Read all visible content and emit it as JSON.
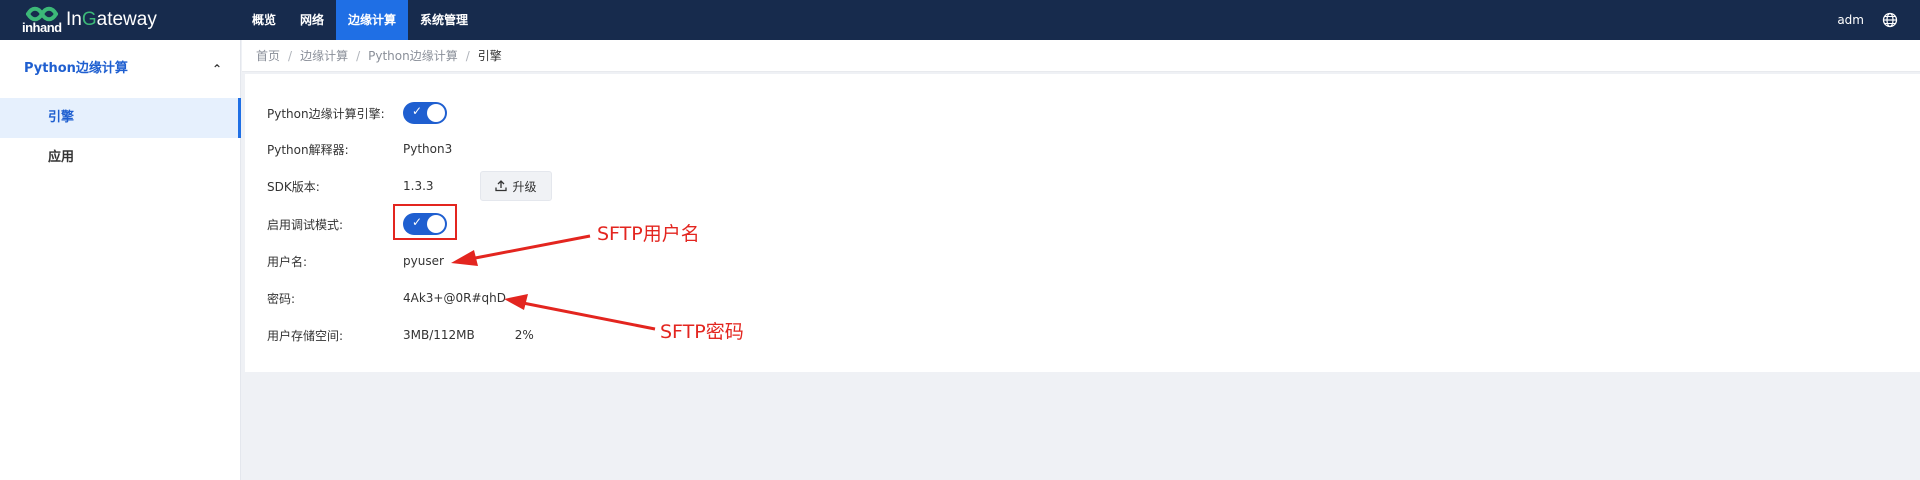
{
  "app": {
    "logo_mark": "inhand",
    "name_prefix": "In",
    "name_g": "G",
    "name_suffix": "ateway"
  },
  "nav": [
    {
      "label": "概览"
    },
    {
      "label": "网络"
    },
    {
      "label": "边缘计算",
      "active": true
    },
    {
      "label": "系统管理"
    }
  ],
  "user": {
    "name": "adm",
    "icon": "globe-icon"
  },
  "sidebar": {
    "group": "Python边缘计算",
    "items": [
      {
        "label": "引擎",
        "active": true
      },
      {
        "label": "应用"
      }
    ]
  },
  "breadcrumb": [
    "首页",
    "边缘计算",
    "Python边缘计算",
    "引擎"
  ],
  "engine": {
    "engine_label": "Python边缘计算引擎:",
    "engine_enabled": true,
    "interpreter_label": "Python解释器:",
    "interpreter_value": "Python3",
    "sdk_label": "SDK版本:",
    "sdk_value": "1.3.3",
    "upgrade_label": "升级",
    "debug_label": "启用调试模式:",
    "debug_enabled": true,
    "username_label": "用户名:",
    "username_value": "pyuser",
    "password_label": "密码:",
    "password_value": "4Ak3+@0R#qhD",
    "storage_label": "用户存储空间:",
    "storage_value": "3MB/112MB",
    "storage_percent": "2%"
  },
  "annotations": {
    "sftp_user": "SFTP用户名",
    "sftp_password": "SFTP密码",
    "color": "#e3251f"
  },
  "colors": {
    "topbar": "#172b4d",
    "accent": "#1f6fe5",
    "toggle": "#1f5fd0",
    "annotation": "#e3251f"
  }
}
